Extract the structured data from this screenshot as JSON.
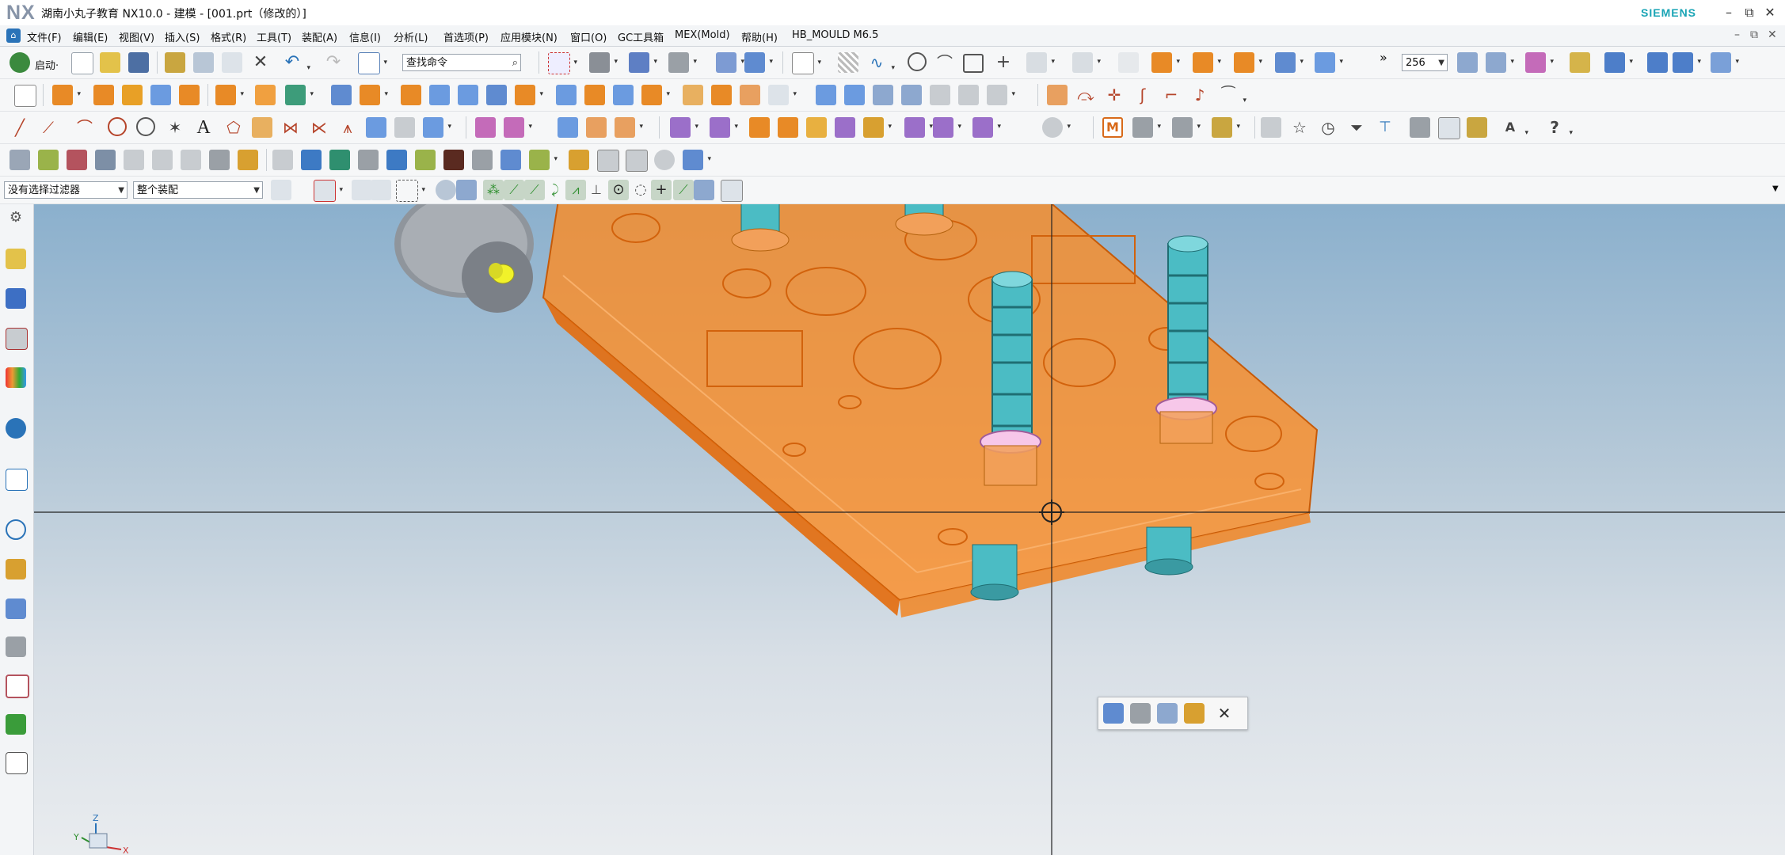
{
  "window": {
    "logo": "NX",
    "title": "湖南小丸子教育 NX10.0 - 建模 - [001.prt（修改的）]",
    "brand": "SIEMENS",
    "controls": [
      "–",
      "⧉",
      "✕"
    ]
  },
  "menubar": {
    "items": [
      "文件(F)",
      "编辑(E)",
      "视图(V)",
      "插入(S)",
      "格式(R)",
      "工具(T)",
      "装配(A)",
      "信息(I)",
      "分析(L)",
      "首选项(P)",
      "应用模块(N)",
      "窗口(O)",
      "GC工具箱",
      "MEX(Mold)",
      "帮助(H)",
      "HB_MOULD M6.5"
    ],
    "doc_controls": [
      "–",
      "⧉",
      "✕"
    ]
  },
  "toolbar1": {
    "start_label": "启动·",
    "search_placeholder": "查找命令",
    "zoom_value": "256",
    "overflow": "»"
  },
  "selection": {
    "filter_value": "没有选择过滤器",
    "scope_value": "整个装配"
  },
  "colors": {
    "accent": "#2a73b8",
    "brand": "#19a4b5",
    "plate": "#ff8a1f",
    "pin": "#4bbcc4",
    "cylinder_cap": "#e8ea20"
  },
  "triad": {
    "x": "X",
    "y": "Y",
    "z": "Z"
  }
}
